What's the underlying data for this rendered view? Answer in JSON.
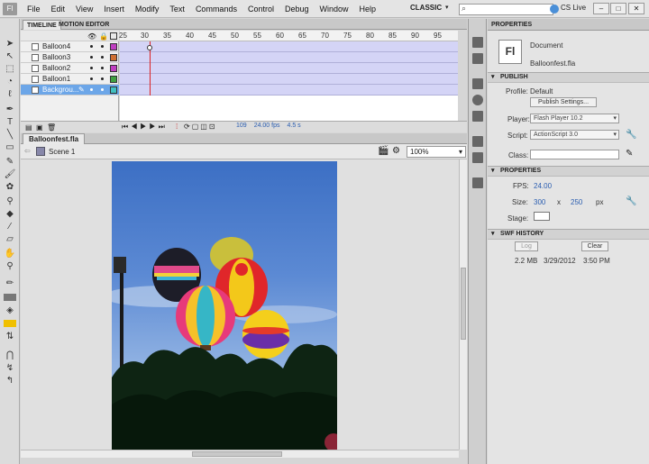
{
  "app": {
    "logo": "Fl",
    "menus": [
      "File",
      "Edit",
      "View",
      "Insert",
      "Modify",
      "Text",
      "Commands",
      "Control",
      "Debug",
      "Window",
      "Help"
    ],
    "workspace": "CLASSIC",
    "search_placeholder": "",
    "cs_live": "CS Live"
  },
  "timeline": {
    "tabs": [
      "TIMELINE",
      "MOTION EDITOR"
    ],
    "ruler_ticks": [
      "25",
      "30",
      "35",
      "40",
      "45",
      "50",
      "55",
      "60",
      "65",
      "70",
      "75",
      "80",
      "85",
      "90",
      "95"
    ],
    "layers": [
      {
        "name": "Balloon4",
        "color": "#c040c0",
        "selected": false
      },
      {
        "name": "Balloon3",
        "color": "#d07030",
        "selected": false
      },
      {
        "name": "Balloon2",
        "color": "#c040c0",
        "selected": false
      },
      {
        "name": "Balloon1",
        "color": "#40a040",
        "selected": false
      },
      {
        "name": "Backgrou...",
        "color": "#40c0c0",
        "selected": true
      }
    ],
    "status": {
      "frame": "109",
      "fps": "24.00 fps",
      "time": "4.5 s"
    }
  },
  "document": {
    "tab": "Balloonfest.fla",
    "scene": "Scene 1",
    "zoom": "100%"
  },
  "properties": {
    "tab": "PROPERTIES",
    "doc_type": "Document",
    "doc_name": "Balloonfest.fla",
    "publish": {
      "header": "PUBLISH",
      "profile_label": "Profile:",
      "profile_value": "Default",
      "publish_settings": "Publish Settings...",
      "player_label": "Player:",
      "player_value": "Flash Player 10.2",
      "script_label": "Script:",
      "script_value": "ActionScript 3.0",
      "class_label": "Class:"
    },
    "props": {
      "header": "PROPERTIES",
      "fps_label": "FPS:",
      "fps_value": "24.00",
      "size_label": "Size:",
      "width": "300",
      "x": "x",
      "height": "250",
      "unit": "px",
      "stage_label": "Stage:",
      "stage_color": "#ffffff"
    },
    "swf_history": {
      "header": "SWF HISTORY",
      "log": "Log",
      "clear": "Clear",
      "size": "2.2 MB",
      "date": "3/29/2012",
      "time": "3:50 PM"
    }
  }
}
